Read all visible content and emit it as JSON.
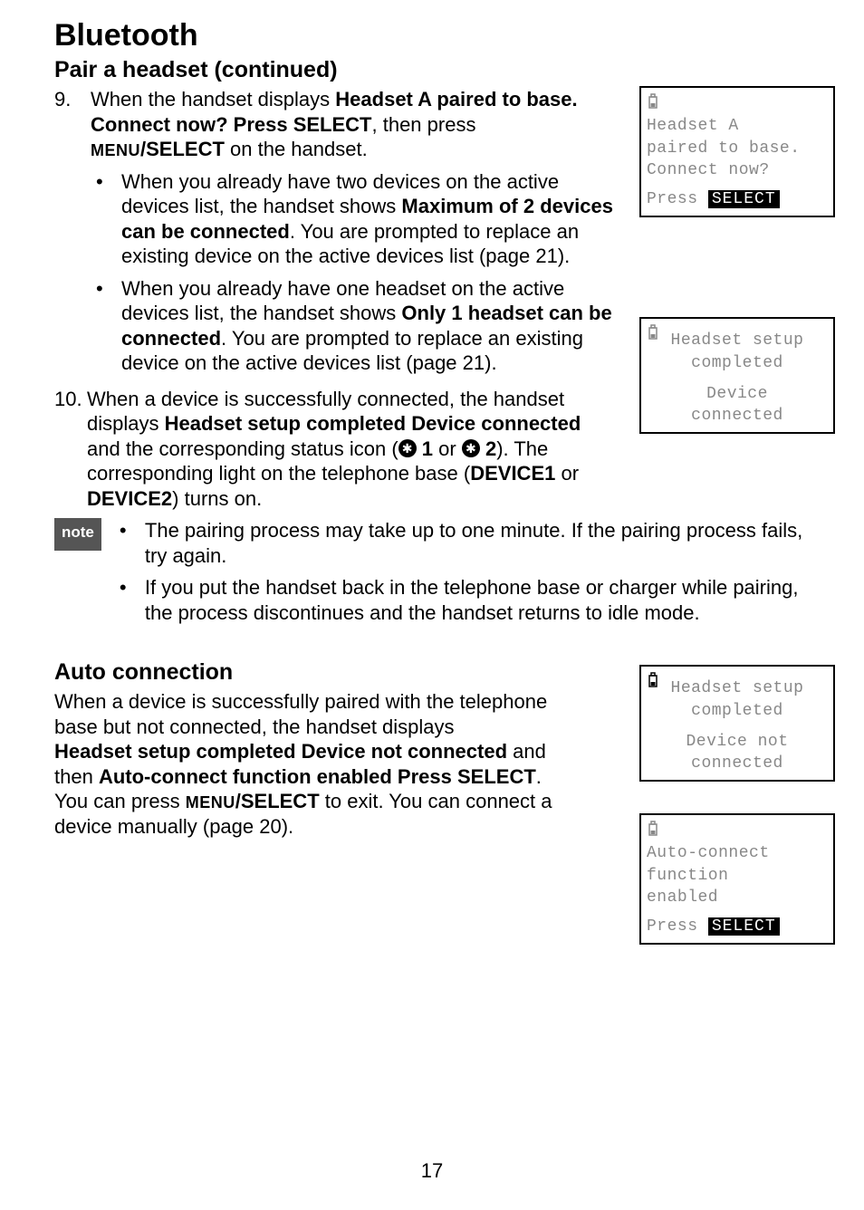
{
  "title": "Bluetooth",
  "section1_heading": "Pair a headset (continued)",
  "step9": {
    "num": "9.",
    "line1_pre": "When the handset displays ",
    "line1_bold": "Headset A paired to base. Connect now? Press SELECT",
    "line1_post": ", then press ",
    "menu_select_caps": "MENU",
    "menu_select_rest": "/SELECT",
    "line1_end": " on the handset.",
    "bullets": [
      {
        "pre": "When you already have two devices on the active devices list, the handset shows ",
        "bold": "Maximum of 2 devices can be connected",
        "post": ". You are prompted to replace an existing device on the active devices list (page 21)."
      },
      {
        "pre": "When you already have one headset on the active devices list, the handset shows ",
        "bold": "Only 1 headset can be connected",
        "post": ". You are prompted to replace an existing device on the active devices list (page 21)."
      }
    ]
  },
  "step10": {
    "num": "10.",
    "line1_pre": "When a device is successfully connected, the handset displays ",
    "bold1": "Headset setup completed Device connected",
    "mid1": " and the corresponding status icon (",
    "bt1": "1",
    "mid2": " or ",
    "bt2": "2",
    "mid3": "). The corresponding light on the telephone base (",
    "dev1": "DEVICE1",
    "or": " or ",
    "dev2": "DEVICE2",
    "end": ") turns on."
  },
  "note_label": "note",
  "note_bullets": [
    "The pairing process may take up to one minute. If the pairing process fails, try again.",
    "If you put the handset back in the telephone base or charger while pairing, the process discontinues and the handset returns to idle mode."
  ],
  "section2_heading": "Auto connection",
  "section2_body": {
    "p1_pre": "When a device is successfully paired with the telephone base but not connected, the handset displays ",
    "p1_bold1": "Headset setup completed Device not connected",
    "p1_mid": " and then ",
    "p1_bold2": "Auto-connect function enabled Press SELECT",
    "p1_post1": ". You can press ",
    "menu_caps": "MENU",
    "menu_rest": "/SELECT",
    "p1_post2": " to exit. You can connect a device manually (page 20)."
  },
  "lcd1": {
    "l1": "Headset A",
    "l2": "paired to base.",
    "l3": "Connect now?",
    "press": "Press",
    "select": "SELECT"
  },
  "lcd2": {
    "l1": "Headset setup",
    "l2": "completed",
    "l3": "Device",
    "l4": "connected"
  },
  "lcd3": {
    "l1": "Headset setup",
    "l2": "completed",
    "l3": "Device not",
    "l4": "connected"
  },
  "lcd4": {
    "l1": "Auto-connect",
    "l2": "function",
    "l3": "enabled",
    "press": "Press",
    "select": "SELECT"
  },
  "page_number": "17"
}
